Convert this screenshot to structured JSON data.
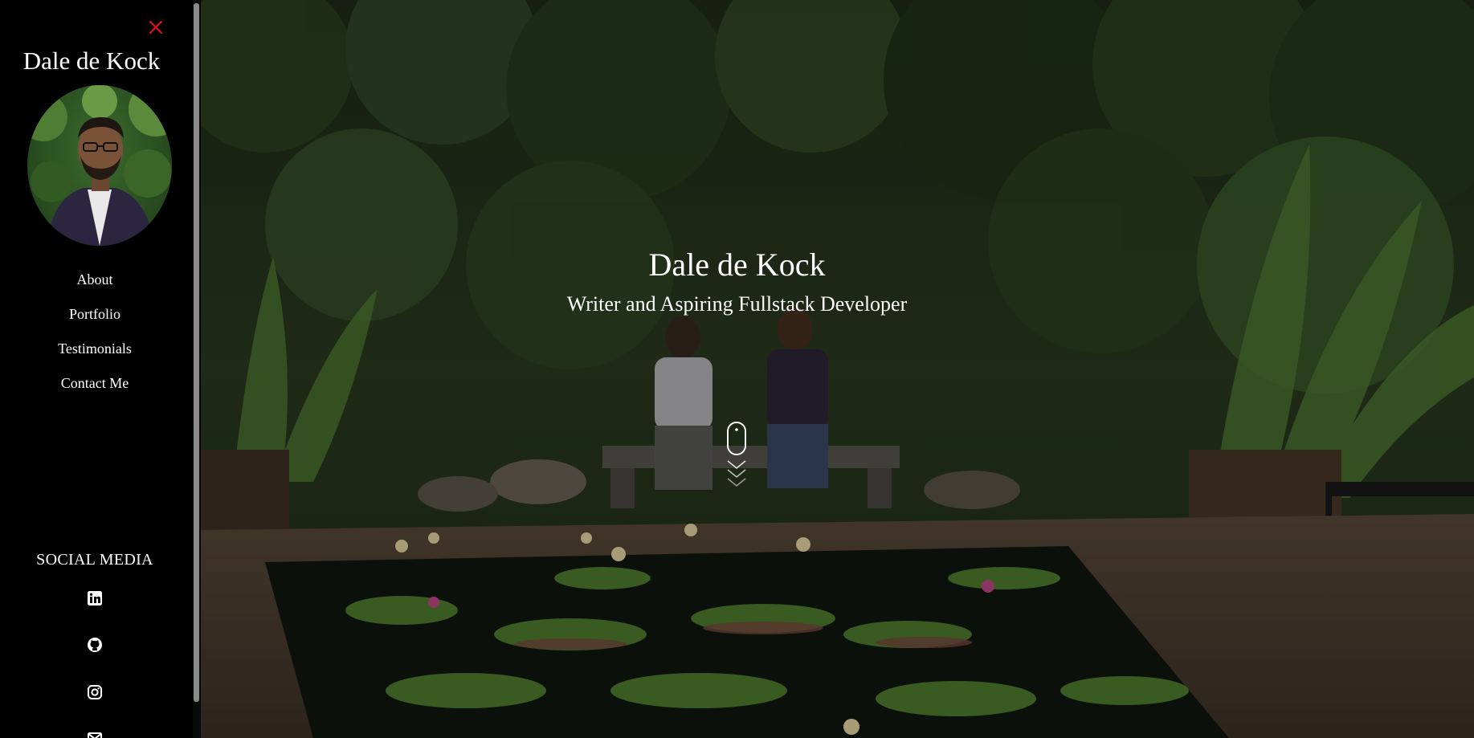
{
  "sidebar": {
    "brand": "Dale de Kock",
    "avatar_alt": "profile-photo",
    "close_icon": "close-icon",
    "nav": [
      {
        "label": "About"
      },
      {
        "label": "Portfolio"
      },
      {
        "label": "Testimonials"
      },
      {
        "label": "Contact Me"
      }
    ],
    "social_heading": "SOCIAL MEDIA",
    "social_icons": [
      "linkedin-icon",
      "github-icon",
      "instagram-icon",
      "email-icon"
    ]
  },
  "hero": {
    "title": "Dale de Kock",
    "subtitle": "Writer and Aspiring Fullstack Developer",
    "scroll_icon": "mouse-scroll-icon"
  },
  "colors": {
    "sidebar_bg": "#000000",
    "close_icon": "#e0101a",
    "text": "#ffffff"
  }
}
